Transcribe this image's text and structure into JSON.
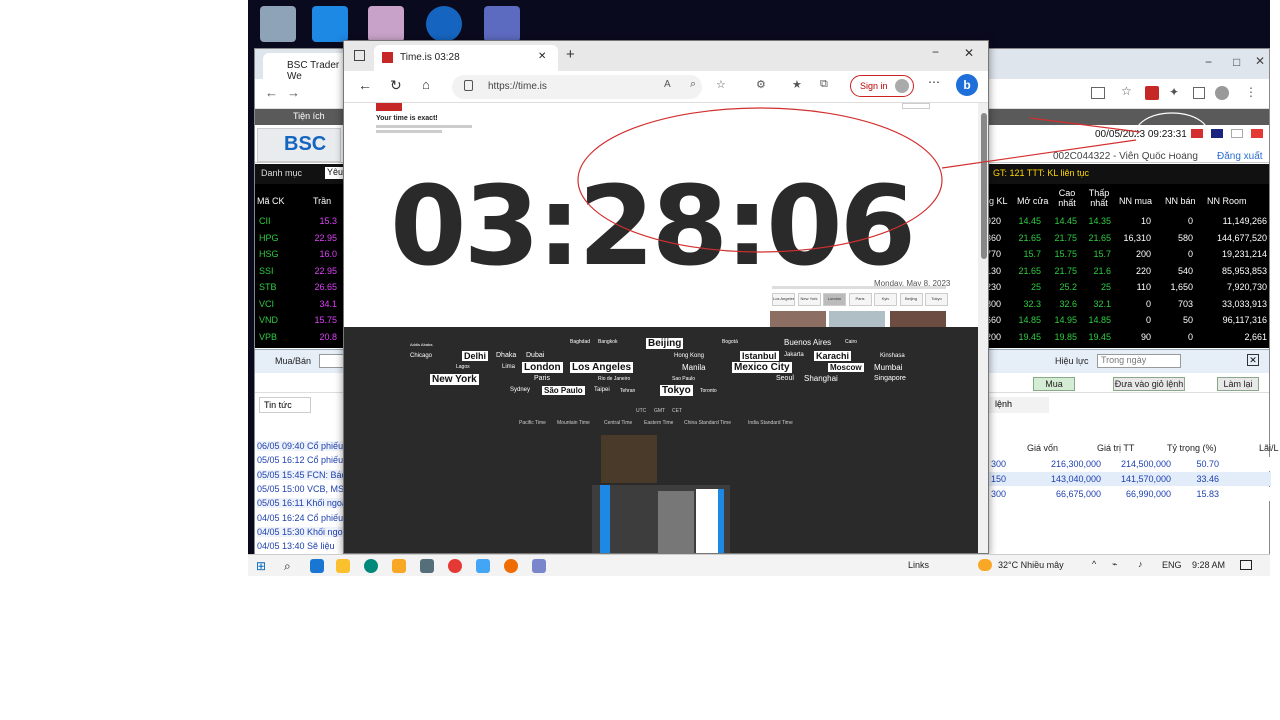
{
  "trader": {
    "tab_title": "BSC Trader We",
    "menu_label": "Tiện ích",
    "logo_text": "BSC",
    "datetime": "00/05/2023 09:23:31",
    "account": "002C044322 - Viên Quốc Hoàng",
    "logout": "Đăng xuất",
    "filter_label": "Danh mục",
    "filter_value": "Yêu",
    "ticker_info": "GT: 121 TTT: KL liên tục",
    "grid_headers": [
      "Mã CK",
      "Trần",
      "g KL",
      "Mở cửa",
      "Cao nhất",
      "Thấp nhất",
      "NN mua",
      "NN bán",
      "NN Room"
    ],
    "rows": [
      {
        "sym": "CII",
        "ref": "15.3",
        "kl": "4,920",
        "open": "14.45",
        "high": "14.45",
        "low": "14.35",
        "buy": "10",
        "sell": "0",
        "room": "11,149,266"
      },
      {
        "sym": "HPG",
        "ref": "22.95",
        "kl": "67,360",
        "open": "21.65",
        "high": "21.75",
        "low": "21.65",
        "buy": "16,310",
        "sell": "580",
        "room": "144,677,520"
      },
      {
        "sym": "HSG",
        "ref": "16.0",
        "kl": "41,770",
        "open": "15.7",
        "high": "15.75",
        "low": "15.7",
        "buy": "200",
        "sell": "0",
        "room": "19,231,214"
      },
      {
        "sym": "SSI",
        "ref": "22.95",
        "kl": "37,130",
        "open": "21.65",
        "high": "21.75",
        "low": "21.6",
        "buy": "220",
        "sell": "540",
        "room": "85,953,853"
      },
      {
        "sym": "STB",
        "ref": "26.65",
        "kl": "21,230",
        "open": "25",
        "high": "25.2",
        "low": "25",
        "buy": "110",
        "sell": "1,650",
        "room": "7,920,730"
      },
      {
        "sym": "VCI",
        "ref": "34.1",
        "kl": "18,800",
        "open": "32.3",
        "high": "32.6",
        "low": "32.1",
        "buy": "0",
        "sell": "703",
        "room": "33,033,913"
      },
      {
        "sym": "VND",
        "ref": "15.75",
        "kl": "36,660",
        "open": "14.85",
        "high": "14.95",
        "low": "14.85",
        "buy": "0",
        "sell": "50",
        "room": "96,117,316"
      },
      {
        "sym": "VPB",
        "ref": "20.8",
        "kl": "8,200",
        "open": "19.45",
        "high": "19.85",
        "low": "19.45",
        "buy": "90",
        "sell": "0",
        "room": "2,661"
      }
    ],
    "order_label": "Mua/Bán",
    "validity_label": "Hiệu lực",
    "validity_value": "Trong ngày",
    "buy_button": "Mua",
    "send_button": "Đưa vào giỏ lệnh",
    "reset_button": "Làm lại",
    "news_tab": "Tin tức",
    "orders_tab": "lệnh",
    "news": [
      "06/05 09:40 Cổ phiếu",
      "05/05 16:12 Cổ phiếu",
      "05/05 15:45 FCN: Báo",
      "05/05 15:00 VCB, MSN",
      "05/05 16:11 Khối ngoại",
      "04/05 16:24 Cổ phiếu",
      "04/05 15:30 Khối ngoại",
      "04/05 13:40 Sẽ liệu"
    ],
    "portfolio_headers": [
      "Giá vốn",
      "Giá trị TT",
      "Tỷ trọng (%)",
      "Lãi/L"
    ],
    "portfolio": [
      {
        "qty": "300",
        "cost": "216,300,000",
        "value": "214,500,000",
        "weight": "50.70"
      },
      {
        "qty": "150",
        "cost": "143,040,000",
        "value": "141,570,000",
        "weight": "33.46"
      },
      {
        "qty": "300",
        "cost": "66,675,000",
        "value": "66,990,000",
        "weight": "15.83"
      }
    ]
  },
  "edge": {
    "tab_title": "Time.is 03:28",
    "url": "https://time.is",
    "signin": "Sign in",
    "exact_text": "Your time is exact!",
    "clock": "03:28:06",
    "date": "Monday, May 8, 2023",
    "cities_small": [
      "Los Angeles",
      "New York",
      "London",
      "Paris",
      "Kyiv",
      "Beijing",
      "Tokyo"
    ],
    "city_words": [
      "Addis Ababa",
      "Baghdad",
      "Bangkok",
      "Beijing",
      "Bogotá",
      "Buenos Aires",
      "Cairo",
      "Chicago",
      "Delhi",
      "Dhaka",
      "Dubai",
      "Hong Kong",
      "Istanbul",
      "Jakarta",
      "Karachi",
      "Kinshasa",
      "Lagos",
      "Lima",
      "London",
      "Los Angeles",
      "Manila",
      "Mexico City",
      "Moscow",
      "Mumbai",
      "New York",
      "Paris",
      "Rio de Janeiro",
      "Sao Paulo",
      "Seoul",
      "Shanghai",
      "Singapore",
      "Sydney",
      "São Paulo",
      "Taipei",
      "Tehran",
      "Tokyo",
      "Toronto"
    ],
    "tz_row1": [
      "UTC",
      "GMT",
      "CET"
    ],
    "tz_row2": [
      "Pacific Time",
      "Mountain Time",
      "Central Time",
      "Eastern Time",
      "China Standard Time",
      "India Standard Time"
    ]
  },
  "taskbar": {
    "links": "Links",
    "weather": "32°C Nhiều mây",
    "lang": "ENG",
    "time": "9:28 AM"
  }
}
